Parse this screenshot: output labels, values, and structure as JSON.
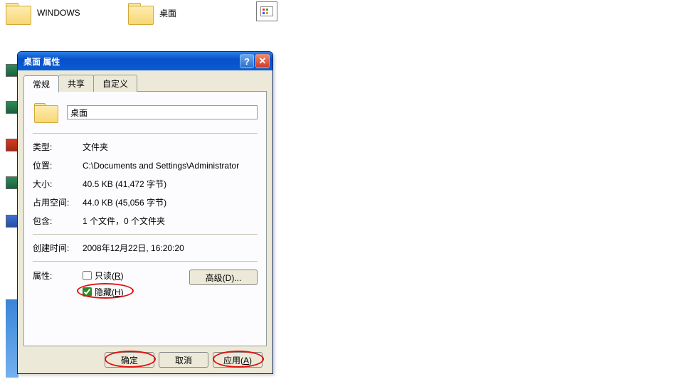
{
  "desktop": {
    "icons": [
      {
        "label": "WINDOWS"
      },
      {
        "label": "桌面"
      }
    ]
  },
  "dialog": {
    "title": "桌面 属性",
    "tabs": [
      {
        "label": "常规",
        "active": true
      },
      {
        "label": "共享",
        "active": false
      },
      {
        "label": "自定义",
        "active": false
      }
    ],
    "name_value": "桌面",
    "props": {
      "type_label": "类型:",
      "type_value": "文件夹",
      "location_label": "位置:",
      "location_value": "C:\\Documents and Settings\\Administrator",
      "size_label": "大小:",
      "size_value": "40.5 KB (41,472 字节)",
      "sizeondisk_label": "占用空间:",
      "sizeondisk_value": "44.0 KB (45,056 字节)",
      "contains_label": "包含:",
      "contains_value": "1 个文件，0 个文件夹",
      "created_label": "创建时间:",
      "created_value": "2008年12月22日, 16:20:20",
      "attr_label": "属性:",
      "readonly_label": "只读(",
      "readonly_key": "R",
      "readonly_suffix": ")",
      "hidden_label": "隐藏(",
      "hidden_key": "H",
      "hidden_suffix": ")",
      "readonly_checked": false,
      "hidden_checked": true,
      "advanced_label": "高级(D)..."
    },
    "buttons": {
      "ok": "确定",
      "cancel": "取消",
      "apply_prefix": "应用(",
      "apply_key": "A",
      "apply_suffix": ")"
    }
  }
}
